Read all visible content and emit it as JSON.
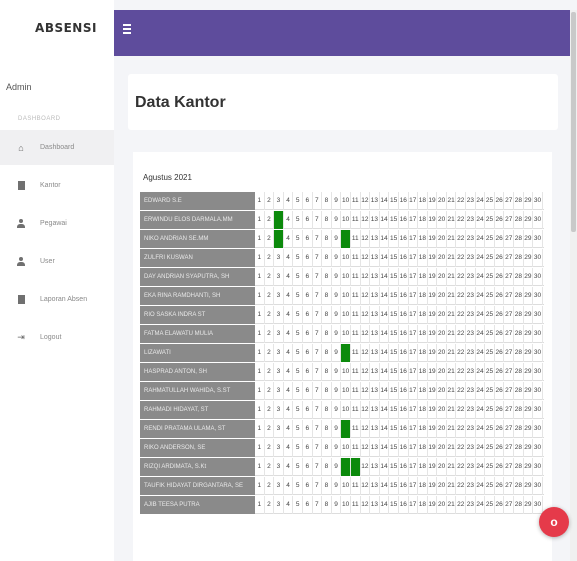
{
  "sidebar": {
    "brand": "ABSENSI",
    "user": "Admin",
    "section_label": "DASHBOARD",
    "items": [
      {
        "label": "Dashboard",
        "icon": "home-icon"
      },
      {
        "label": "Kantor",
        "icon": "document-icon"
      },
      {
        "label": "Pegawai",
        "icon": "user-icon"
      },
      {
        "label": "User",
        "icon": "user-icon"
      },
      {
        "label": "Laporan Absen",
        "icon": "report-icon"
      },
      {
        "label": "Logout",
        "icon": "logout-icon"
      }
    ]
  },
  "header": {
    "title": "Data Kantor"
  },
  "report": {
    "period": "Agustus 2021",
    "days": [
      "1",
      "2",
      "3",
      "4",
      "5",
      "6",
      "7",
      "8",
      "9",
      "10",
      "11",
      "12",
      "13",
      "14",
      "15",
      "16",
      "17",
      "18",
      "19",
      "20",
      "21",
      "22",
      "23",
      "24",
      "25",
      "26",
      "27",
      "28",
      "29",
      "30"
    ],
    "rows": [
      {
        "name": "EDWARD S.E",
        "present": []
      },
      {
        "name": "ERWINDU ELOS DARMALA.MM",
        "present": [
          3
        ]
      },
      {
        "name": "NIKO ANDRIAN SE.MM",
        "present": [
          3,
          10
        ]
      },
      {
        "name": "ZULFRI KUSWAN",
        "present": []
      },
      {
        "name": "DAY ANDRIAN SYAPUTRA, SH",
        "present": []
      },
      {
        "name": "EKA RINA RAMDHANTI, SH",
        "present": []
      },
      {
        "name": "RIO SASKA INDRA ST",
        "present": []
      },
      {
        "name": "FATMA ELAWATU MULIA",
        "present": []
      },
      {
        "name": "LIZAWATI",
        "present": [
          10
        ]
      },
      {
        "name": "HASPRAD ANTON, SH",
        "present": []
      },
      {
        "name": "RAHMATULLAH WAHIDA, S.ST",
        "present": []
      },
      {
        "name": "RAHMADI HIDAYAT, ST",
        "present": []
      },
      {
        "name": "RENDI PRATAMA ULAMA, ST",
        "present": [
          10
        ]
      },
      {
        "name": "RIKO ANDERSON, SE",
        "present": []
      },
      {
        "name": "RIZQI ARDIMATA, S.Kt",
        "present": [
          10,
          11
        ]
      },
      {
        "name": "TAUFIK HIDAYAT DIRGANTARA, SE",
        "present": []
      },
      {
        "name": "AJIB TEESA PUTRA",
        "present": []
      }
    ]
  },
  "colors": {
    "topbar": "#5e4c9c",
    "present": "#0c8a0c",
    "fab": "#e53a4a"
  }
}
